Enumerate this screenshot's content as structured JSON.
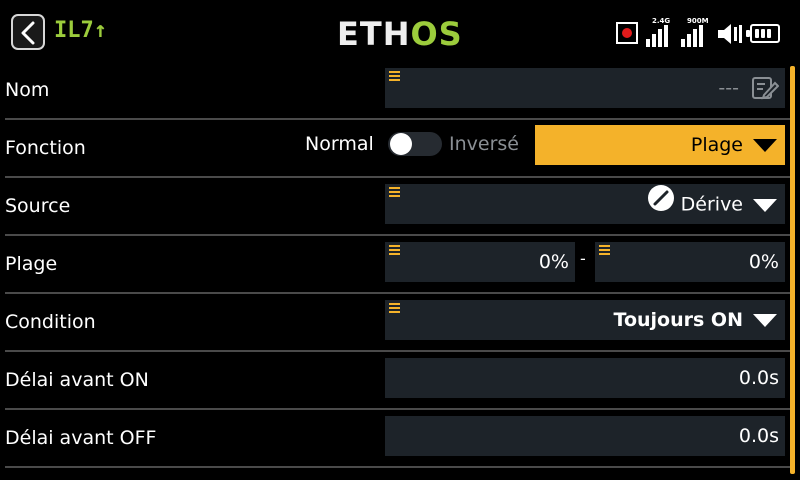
{
  "header": {
    "back_icon": "chevron-left-icon",
    "switch_name": "IL7",
    "switch_arrow": "↑",
    "logo_part1": "ETH",
    "logo_part2": "OS",
    "status": {
      "record_icon": "record-icon",
      "rf1_label": "2.4G",
      "rf2_label": "900M",
      "speaker_icon": "speaker-icon",
      "battery_icon": "battery-icon"
    }
  },
  "colors": {
    "accent": "#f4b22a",
    "brand_green": "#9ccc3c",
    "field_bg": "#1d2329",
    "record_red": "#e21b1b"
  },
  "rows": {
    "nom": {
      "label": "Nom",
      "value": "---",
      "icon": "edit-icon"
    },
    "fonction": {
      "label": "Fonction",
      "toggle_off_label": "Normal",
      "toggle_on_label": "Inversé",
      "toggle_state": "off",
      "value": "Plage"
    },
    "source": {
      "label": "Source",
      "value": "Dérive",
      "icon": "slash-circle-icon"
    },
    "plage": {
      "label": "Plage",
      "min": "0%",
      "separator": "-",
      "max": "0%"
    },
    "condition": {
      "label": "Condition",
      "value": "Toujours ON"
    },
    "delai_on": {
      "label": "Délai avant ON",
      "value": "0.0s"
    },
    "delai_off": {
      "label": "Délai avant OFF",
      "value": "0.0s"
    }
  }
}
